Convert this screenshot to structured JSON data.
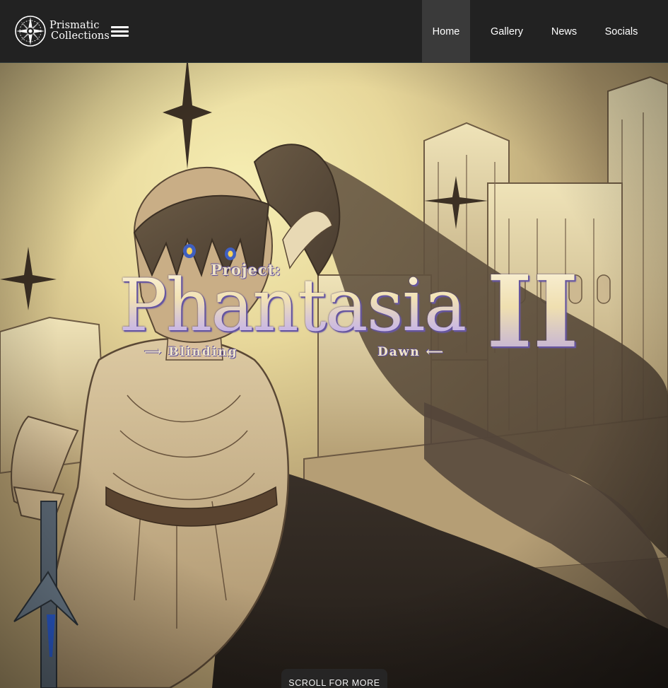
{
  "brand": {
    "line1": "Prismatic",
    "line2": "Collections",
    "emblem_icon": "compass-star-icon"
  },
  "nav": {
    "menu_icon": "hamburger-menu-icon",
    "items": [
      {
        "label": "Home",
        "active": true
      },
      {
        "label": "Gallery",
        "active": false
      },
      {
        "label": "News",
        "active": false
      },
      {
        "label": "Socials",
        "active": false
      }
    ]
  },
  "hero": {
    "logo": {
      "prefix": "Project:",
      "title": "Phantasia",
      "numeral": "II",
      "subtitle_left": "⟶ Blinding",
      "subtitle_right": "Dawn ⟵"
    },
    "scroll_label": "SCROLL FOR MORE"
  },
  "colors": {
    "navbar_bg": "#222222",
    "active_tab_bg": "#3a3a3a",
    "logo_gold": "#f2e2b4",
    "logo_lavender": "#9f90d6",
    "sky_glow": "#f3e7a6"
  }
}
